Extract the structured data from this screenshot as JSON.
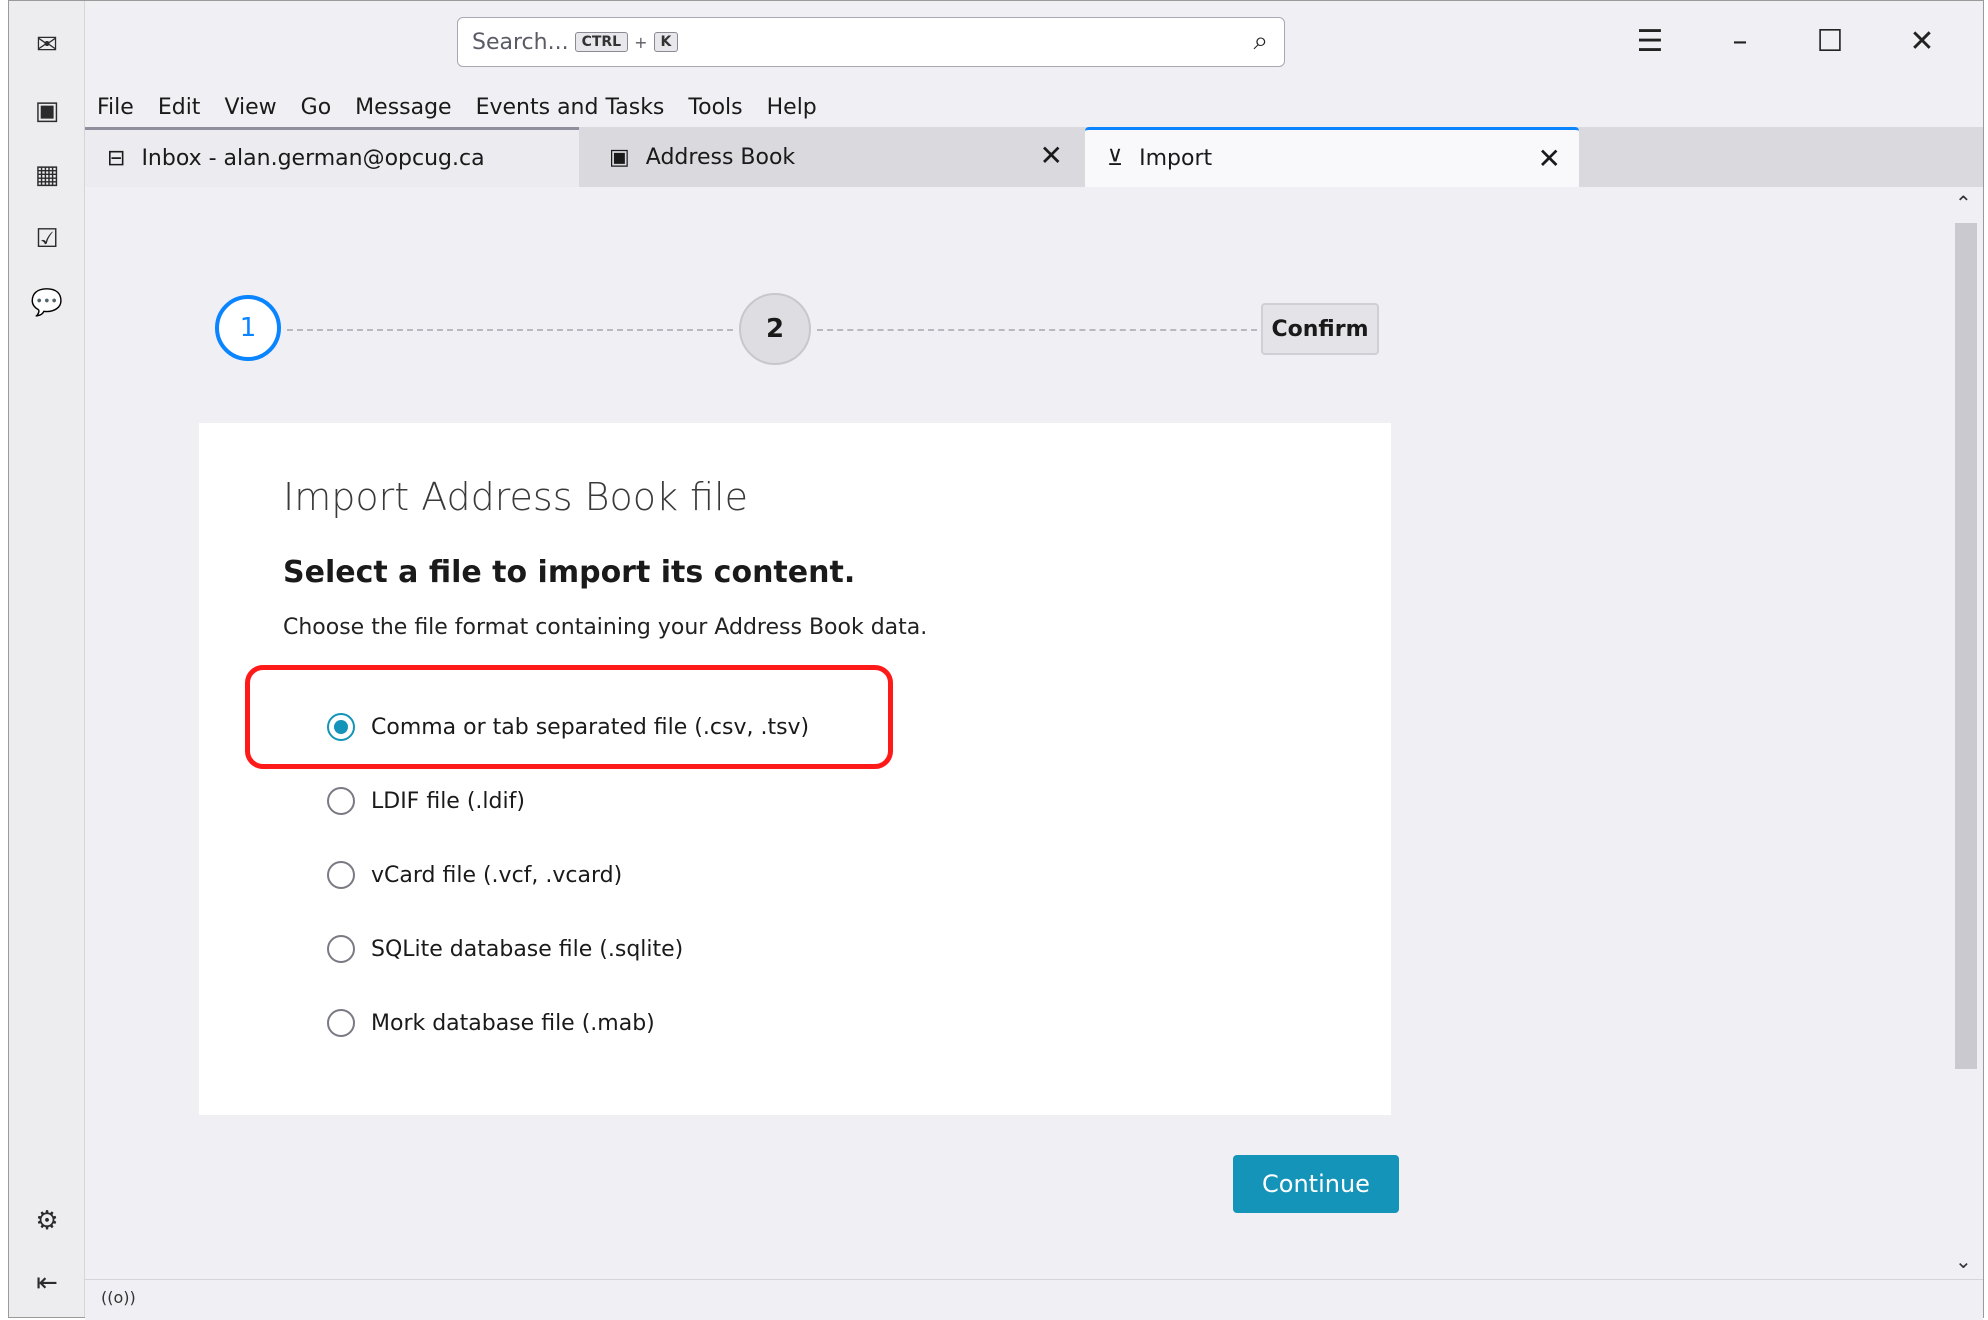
{
  "search": {
    "placeholder": "Search...",
    "key1": "CTRL",
    "plus": "+",
    "key2": "K"
  },
  "menu": [
    "File",
    "Edit",
    "View",
    "Go",
    "Message",
    "Events and Tasks",
    "Tools",
    "Help"
  ],
  "tabs": [
    {
      "label": "Inbox - alan.german@opcug.ca",
      "icon": "inbox-icon"
    },
    {
      "label": "Address Book",
      "icon": "address-book-icon"
    },
    {
      "label": "Import",
      "icon": "import-icon"
    }
  ],
  "steps": {
    "one": "1",
    "two": "2",
    "confirm": "Confirm"
  },
  "card": {
    "title": "Import Address Book file",
    "subtitle": "Select a file to import its content.",
    "description": "Choose the file format containing your Address Book data.",
    "options": [
      {
        "label": "Comma or tab separated file (.csv, .tsv)",
        "checked": true
      },
      {
        "label": "LDIF file (.ldif)",
        "checked": false
      },
      {
        "label": "vCard file (.vcf, .vcard)",
        "checked": false
      },
      {
        "label": "SQLite database file (.sqlite)",
        "checked": false
      },
      {
        "label": "Mork database file (.mab)",
        "checked": false
      }
    ]
  },
  "continue_label": "Continue",
  "colors": {
    "accent": "#1494b8",
    "step_active": "#0a84ff",
    "highlight": "#ff1a1a"
  }
}
